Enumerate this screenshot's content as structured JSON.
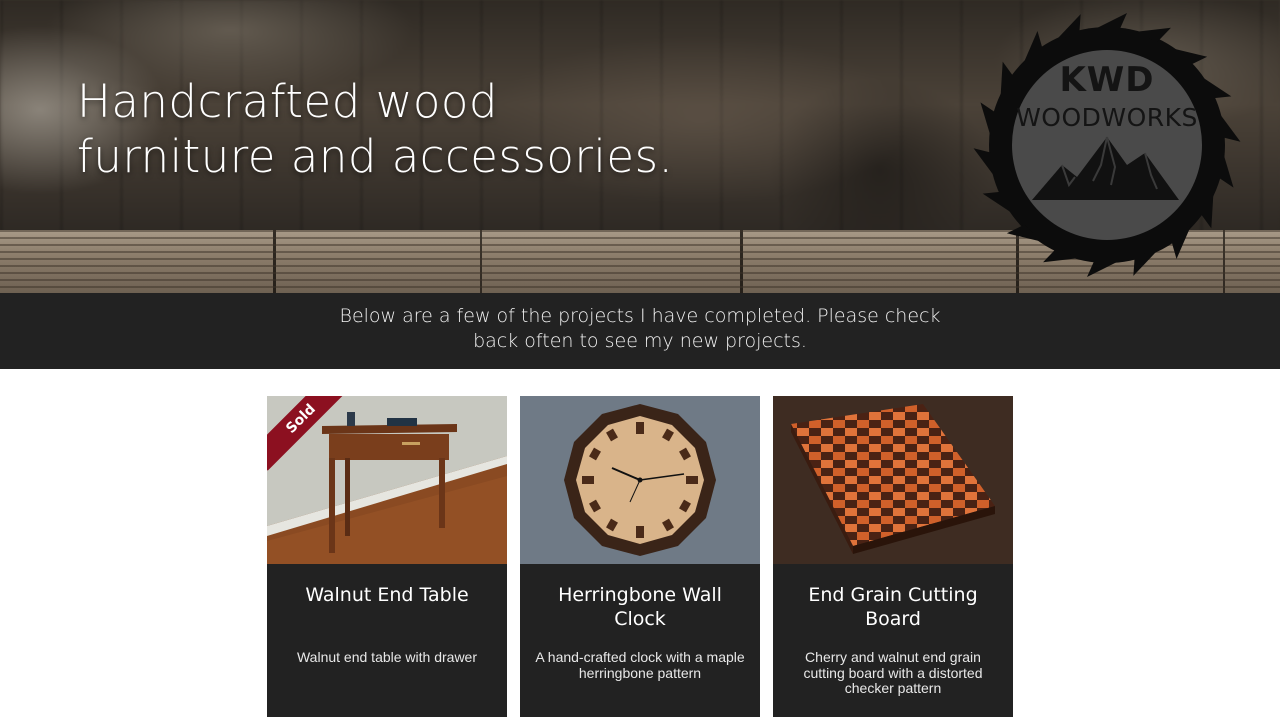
{
  "hero": {
    "title_line1": "Handcrafted wood",
    "title_line2": "furniture and accessories."
  },
  "logo": {
    "line1": "KWD",
    "line2": "WOODWORKS"
  },
  "banner": {
    "text": "Below are a few of the projects I have completed. Please check back often to see my new projects."
  },
  "projects": [
    {
      "title": "Walnut End Table",
      "description": "Walnut end table with drawer",
      "badge": "Sold"
    },
    {
      "title": "Herringbone Wall Clock",
      "description": "A hand-crafted clock with a maple herringbone pattern"
    },
    {
      "title": "End Grain Cutting Board",
      "description": "Cherry and walnut end grain cutting board with a distorted checker pattern"
    }
  ],
  "colors": {
    "banner_bg": "#222222",
    "card_bg": "#222222",
    "sold_ribbon": "#8c1020"
  }
}
